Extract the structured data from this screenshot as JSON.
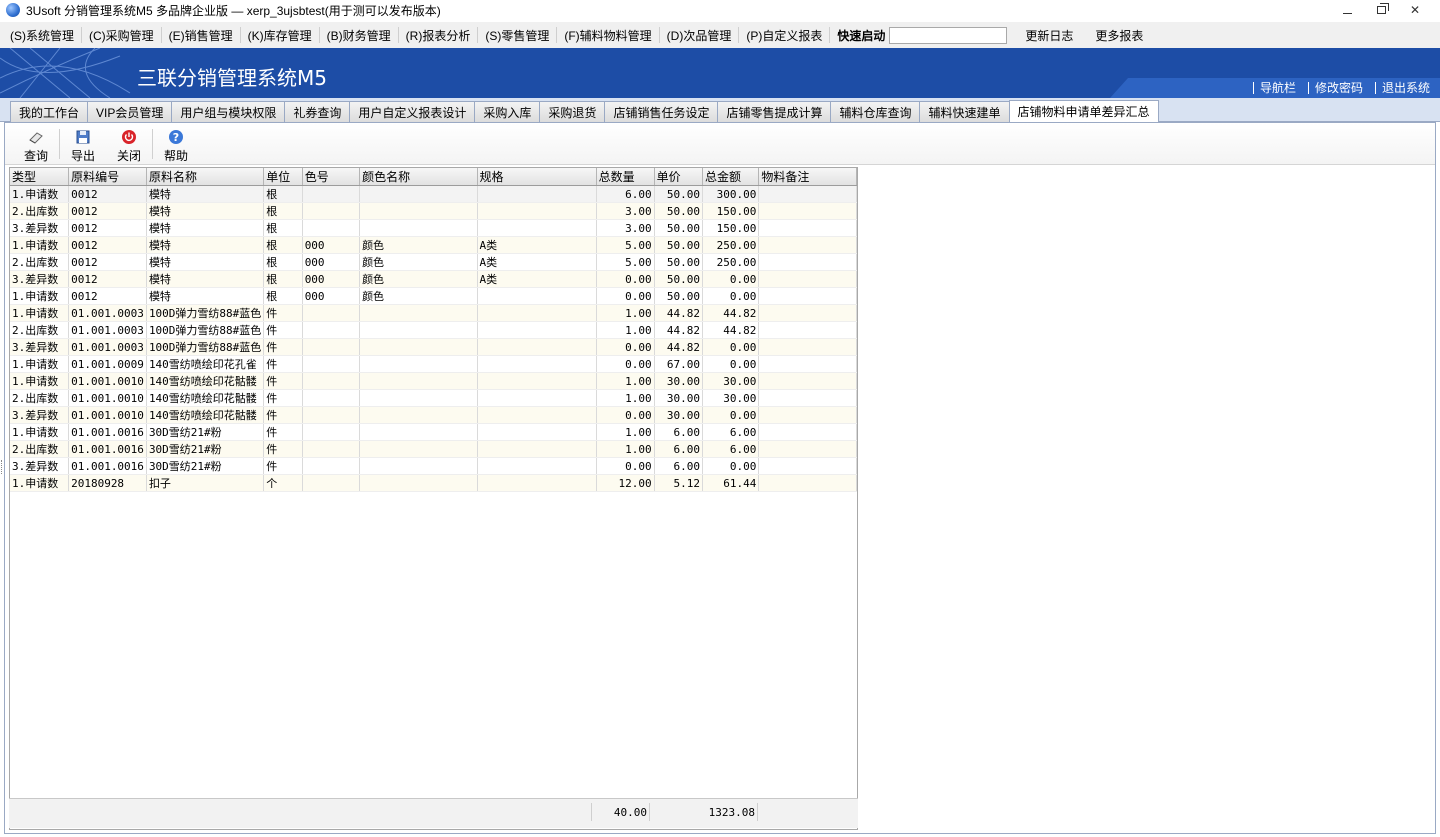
{
  "window": {
    "title": "3Usoft 分销管理系统M5 多品牌企业版 — xerp_3ujsbtest(用于测可以发布版本)"
  },
  "menu": {
    "items": [
      {
        "label": "(S)系统管理"
      },
      {
        "label": "(C)采购管理"
      },
      {
        "label": "(E)销售管理"
      },
      {
        "label": "(K)库存管理"
      },
      {
        "label": "(B)财务管理"
      },
      {
        "label": "(R)报表分析"
      },
      {
        "label": "(S)零售管理"
      },
      {
        "label": "(F)辅料物料管理"
      },
      {
        "label": "(D)次品管理"
      },
      {
        "label": "(P)自定义报表"
      }
    ],
    "quick_label": "快速启动",
    "quick_value": "",
    "update_log": "更新日志",
    "more_reports": "更多报表"
  },
  "banner": {
    "title": "三联分销管理系统M5",
    "nav": "导航栏",
    "change_password": "修改密码",
    "logout": "退出系统"
  },
  "tabs": [
    {
      "label": "我的工作台"
    },
    {
      "label": "VIP会员管理"
    },
    {
      "label": "用户组与模块权限"
    },
    {
      "label": "礼券查询"
    },
    {
      "label": "用户自定义报表设计"
    },
    {
      "label": "采购入库"
    },
    {
      "label": "采购退货"
    },
    {
      "label": "店铺销售任务设定"
    },
    {
      "label": "店铺零售提成计算"
    },
    {
      "label": "辅料仓库查询"
    },
    {
      "label": "辅料快速建单"
    },
    {
      "label": "店铺物料申请单差异汇总",
      "active": true
    }
  ],
  "toolbar": {
    "query": "查询",
    "export": "导出",
    "close": "关闭",
    "help": "帮助"
  },
  "grid": {
    "columns": [
      "类型",
      "原料编号",
      "原料名称",
      "单位",
      "色号",
      "颜色名称",
      "规格",
      "总数量",
      "单价",
      "总金额",
      "物料备注"
    ],
    "rows": [
      [
        "1.申请数",
        "0012",
        "模特",
        "根",
        "",
        "",
        "",
        "6.00",
        "50.00",
        "300.00",
        ""
      ],
      [
        "2.出库数",
        "0012",
        "模特",
        "根",
        "",
        "",
        "",
        "3.00",
        "50.00",
        "150.00",
        ""
      ],
      [
        "3.差异数",
        "0012",
        "模特",
        "根",
        "",
        "",
        "",
        "3.00",
        "50.00",
        "150.00",
        ""
      ],
      [
        "1.申请数",
        "0012",
        "模特",
        "根",
        "000",
        "颜色",
        "A类",
        "5.00",
        "50.00",
        "250.00",
        ""
      ],
      [
        "2.出库数",
        "0012",
        "模特",
        "根",
        "000",
        "颜色",
        "A类",
        "5.00",
        "50.00",
        "250.00",
        ""
      ],
      [
        "3.差异数",
        "0012",
        "模特",
        "根",
        "000",
        "颜色",
        "A类",
        "0.00",
        "50.00",
        "0.00",
        ""
      ],
      [
        "1.申请数",
        "0012",
        "模特",
        "根",
        "000",
        "颜色",
        "",
        "0.00",
        "50.00",
        "0.00",
        ""
      ],
      [
        "1.申请数",
        "01.001.0003",
        "100D弹力雪纺88#蓝色",
        "件",
        "",
        "",
        "",
        "1.00",
        "44.82",
        "44.82",
        ""
      ],
      [
        "2.出库数",
        "01.001.0003",
        "100D弹力雪纺88#蓝色",
        "件",
        "",
        "",
        "",
        "1.00",
        "44.82",
        "44.82",
        ""
      ],
      [
        "3.差异数",
        "01.001.0003",
        "100D弹力雪纺88#蓝色",
        "件",
        "",
        "",
        "",
        "0.00",
        "44.82",
        "0.00",
        ""
      ],
      [
        "1.申请数",
        "01.001.0009",
        "140雪纺喷绘印花孔雀",
        "件",
        "",
        "",
        "",
        "0.00",
        "67.00",
        "0.00",
        ""
      ],
      [
        "1.申请数",
        "01.001.0010",
        "140雪纺喷绘印花骷髅",
        "件",
        "",
        "",
        "",
        "1.00",
        "30.00",
        "30.00",
        ""
      ],
      [
        "2.出库数",
        "01.001.0010",
        "140雪纺喷绘印花骷髅",
        "件",
        "",
        "",
        "",
        "1.00",
        "30.00",
        "30.00",
        ""
      ],
      [
        "3.差异数",
        "01.001.0010",
        "140雪纺喷绘印花骷髅",
        "件",
        "",
        "",
        "",
        "0.00",
        "30.00",
        "0.00",
        ""
      ],
      [
        "1.申请数",
        "01.001.0016",
        "30D雪纺21#粉",
        "件",
        "",
        "",
        "",
        "1.00",
        "6.00",
        "6.00",
        ""
      ],
      [
        "2.出库数",
        "01.001.0016",
        "30D雪纺21#粉",
        "件",
        "",
        "",
        "",
        "1.00",
        "6.00",
        "6.00",
        ""
      ],
      [
        "3.差异数",
        "01.001.0016",
        "30D雪纺21#粉",
        "件",
        "",
        "",
        "",
        "0.00",
        "6.00",
        "0.00",
        ""
      ],
      [
        "1.申请数",
        "20180928",
        "扣子",
        "个",
        "",
        "",
        "",
        "12.00",
        "5.12",
        "61.44",
        ""
      ]
    ],
    "totals": {
      "quantity": "40.00",
      "amount": "1323.08"
    }
  }
}
